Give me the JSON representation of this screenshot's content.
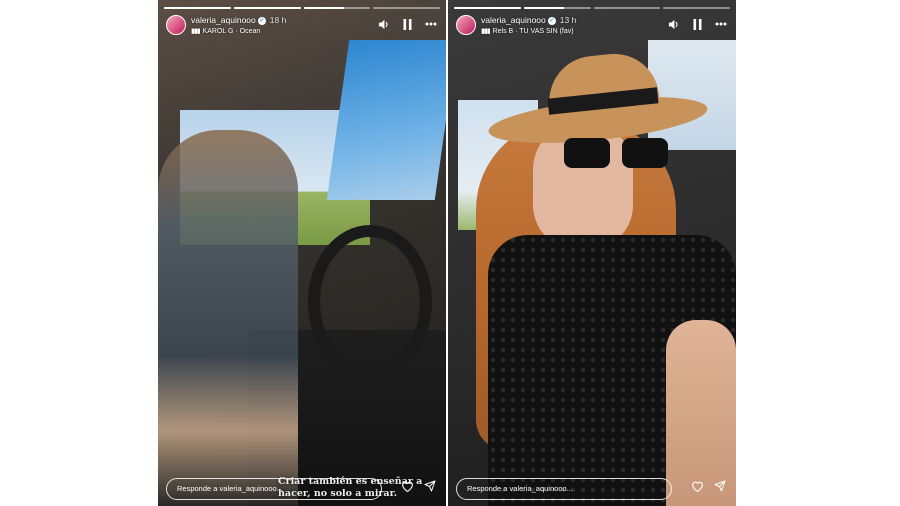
{
  "stories": [
    {
      "username": "valeria_aquinooo",
      "verified": true,
      "time_ago": "18 h",
      "music": "KAROL G · Ocean",
      "progress": [
        1,
        1,
        0.6,
        0
      ],
      "caption": "Criar también es enseñar a hacer, no solo a mirar.",
      "reply_placeholder": "Responde a valeria_aquinooo..."
    },
    {
      "username": "valeria_aquinooo",
      "verified": true,
      "time_ago": "13 h",
      "music": "Rels B · TU VAS SIN (fav)",
      "progress": [
        1,
        0.6,
        0,
        0
      ],
      "caption": "",
      "reply_placeholder": "Responde a valeria_aquinooo..."
    }
  ],
  "icons": {
    "sound": "volume-icon",
    "pause": "pause-icon",
    "more": "more-icon",
    "like": "heart-icon",
    "share": "send-icon",
    "verified": "verified-badge-icon",
    "music": "music-bars-icon"
  },
  "colors": {
    "verified": "#1d9bf0",
    "avatar_ring": "#ffffff"
  }
}
